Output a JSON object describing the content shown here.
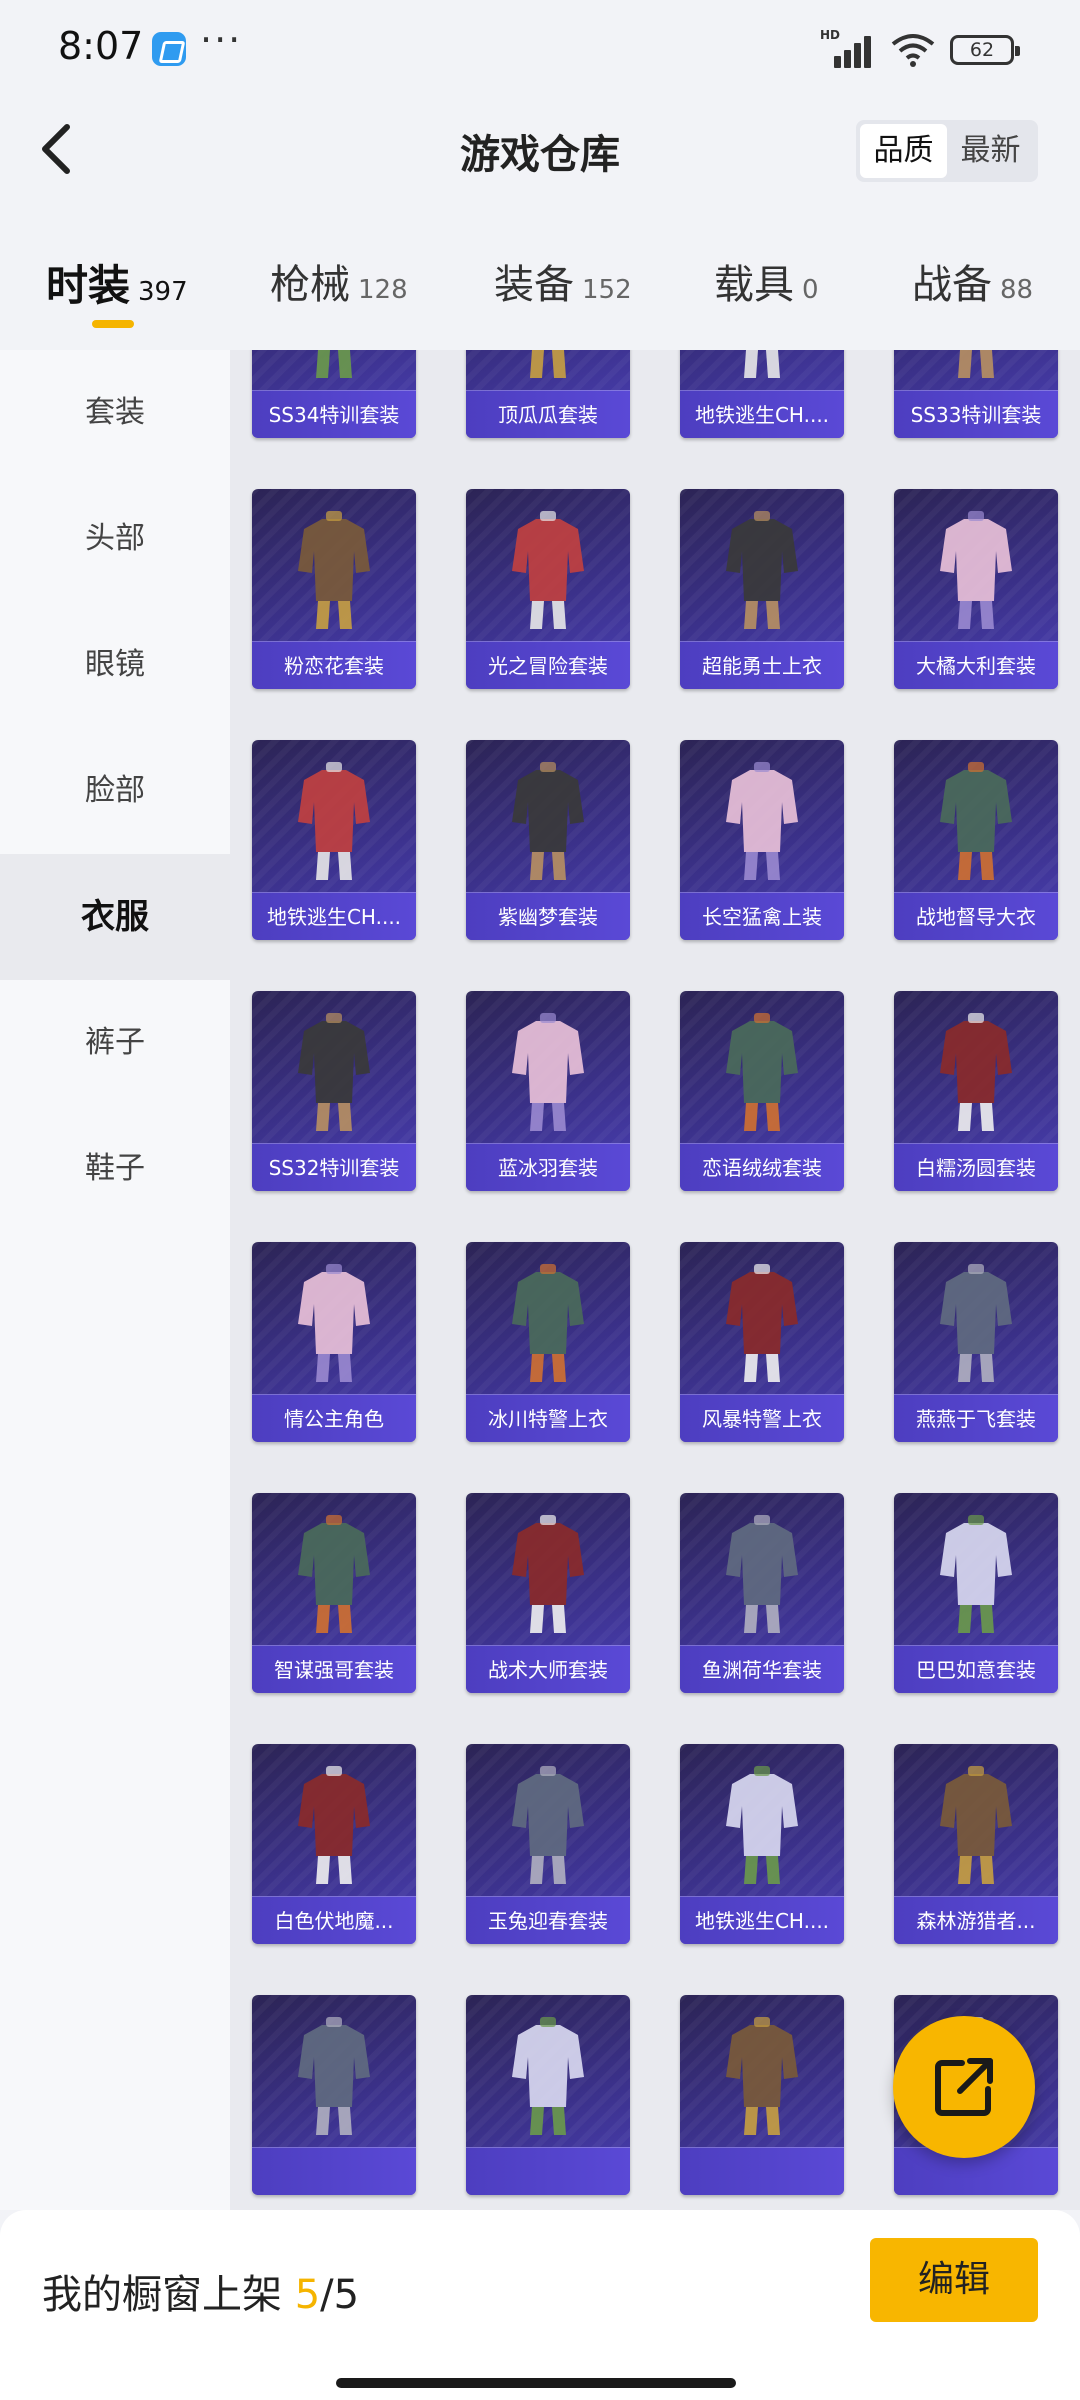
{
  "status_bar": {
    "time": "8:07",
    "dots": "···",
    "hd": "HD",
    "battery": "62"
  },
  "header": {
    "title": "游戏仓库",
    "sort_options": [
      "品质",
      "最新"
    ],
    "sort_active": 0
  },
  "categories": [
    {
      "name": "时装",
      "count": "397",
      "active": true
    },
    {
      "name": "枪械",
      "count": "128"
    },
    {
      "name": "装备",
      "count": "152"
    },
    {
      "name": "载具",
      "count": "0"
    },
    {
      "name": "战备",
      "count": "88"
    }
  ],
  "sidebar": [
    {
      "label": "套装"
    },
    {
      "label": "头部"
    },
    {
      "label": "眼镜"
    },
    {
      "label": "脸部"
    },
    {
      "label": "衣服",
      "active": true
    },
    {
      "label": "裤子"
    },
    {
      "label": "鞋子"
    }
  ],
  "items": [
    [
      "SS34特训套装",
      "顶瓜瓜套装",
      "地铁逃生CH....",
      "SS33特训套装"
    ],
    [
      "粉恋花套装",
      "光之冒险套装",
      "超能勇士上衣",
      "大橘大利套装"
    ],
    [
      "地铁逃生CH....",
      "紫幽梦套装",
      "长空猛禽上装",
      "战地督导大衣"
    ],
    [
      "SS32特训套装",
      "蓝冰羽套装",
      "恋语绒绒套装",
      "白糯汤圆套装"
    ],
    [
      "情公主角色",
      "冰川特警上衣",
      "风暴特警上衣",
      "燕燕于飞套装"
    ],
    [
      "智谋强哥套装",
      "战术大师套装",
      "鱼渊荷华套装",
      "巴巴如意套装"
    ],
    [
      "白色伏地魔...",
      "玉兔迎春套装",
      "地铁逃生CH....",
      "森林游猎者..."
    ],
    [
      "",
      "",
      "",
      ""
    ]
  ],
  "bottom_bar": {
    "label": "我的橱窗上架",
    "current": "5",
    "sep": "/",
    "total": "5",
    "edit_label": "编辑"
  },
  "colors": {
    "accent": "#f8b600",
    "card": "#3b318a",
    "card_bar": "#5a49d6"
  }
}
